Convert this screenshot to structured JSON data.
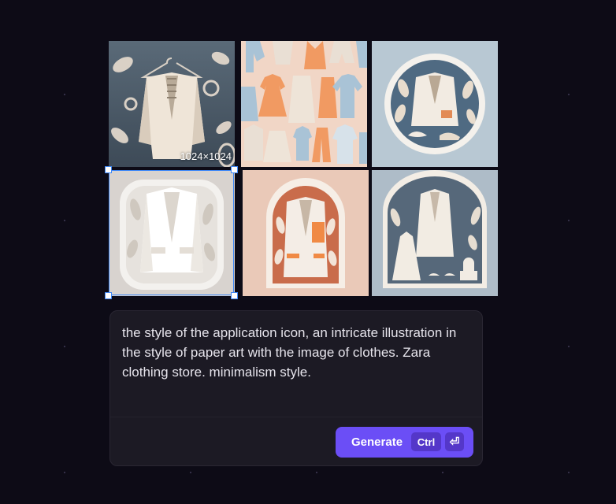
{
  "images": [
    {
      "alt": "paper art blazer on hanger with floral cutouts",
      "size_label": "1024×1024"
    },
    {
      "alt": "pattern of paper cut clothing items"
    },
    {
      "alt": "circular paper art emblem with shirt and shoes"
    },
    {
      "alt": "rounded icon with white paper cut jacket",
      "selected": true
    },
    {
      "alt": "arched paper art with jacket and orange accents"
    },
    {
      "alt": "arched window with jacket, dress and shoes"
    }
  ],
  "prompt": {
    "text": "the style of the application icon, an intricate illustration in the style of paper art with the image of clothes. Zara clothing store. minimalism style."
  },
  "generate": {
    "label": "Generate",
    "shortcut_modifier": "Ctrl",
    "shortcut_key": "⏎"
  },
  "colors": {
    "background": "#0d0b16",
    "panel": "#1c1a24",
    "accent": "#6b4ef6",
    "selection": "#3f87f5"
  }
}
